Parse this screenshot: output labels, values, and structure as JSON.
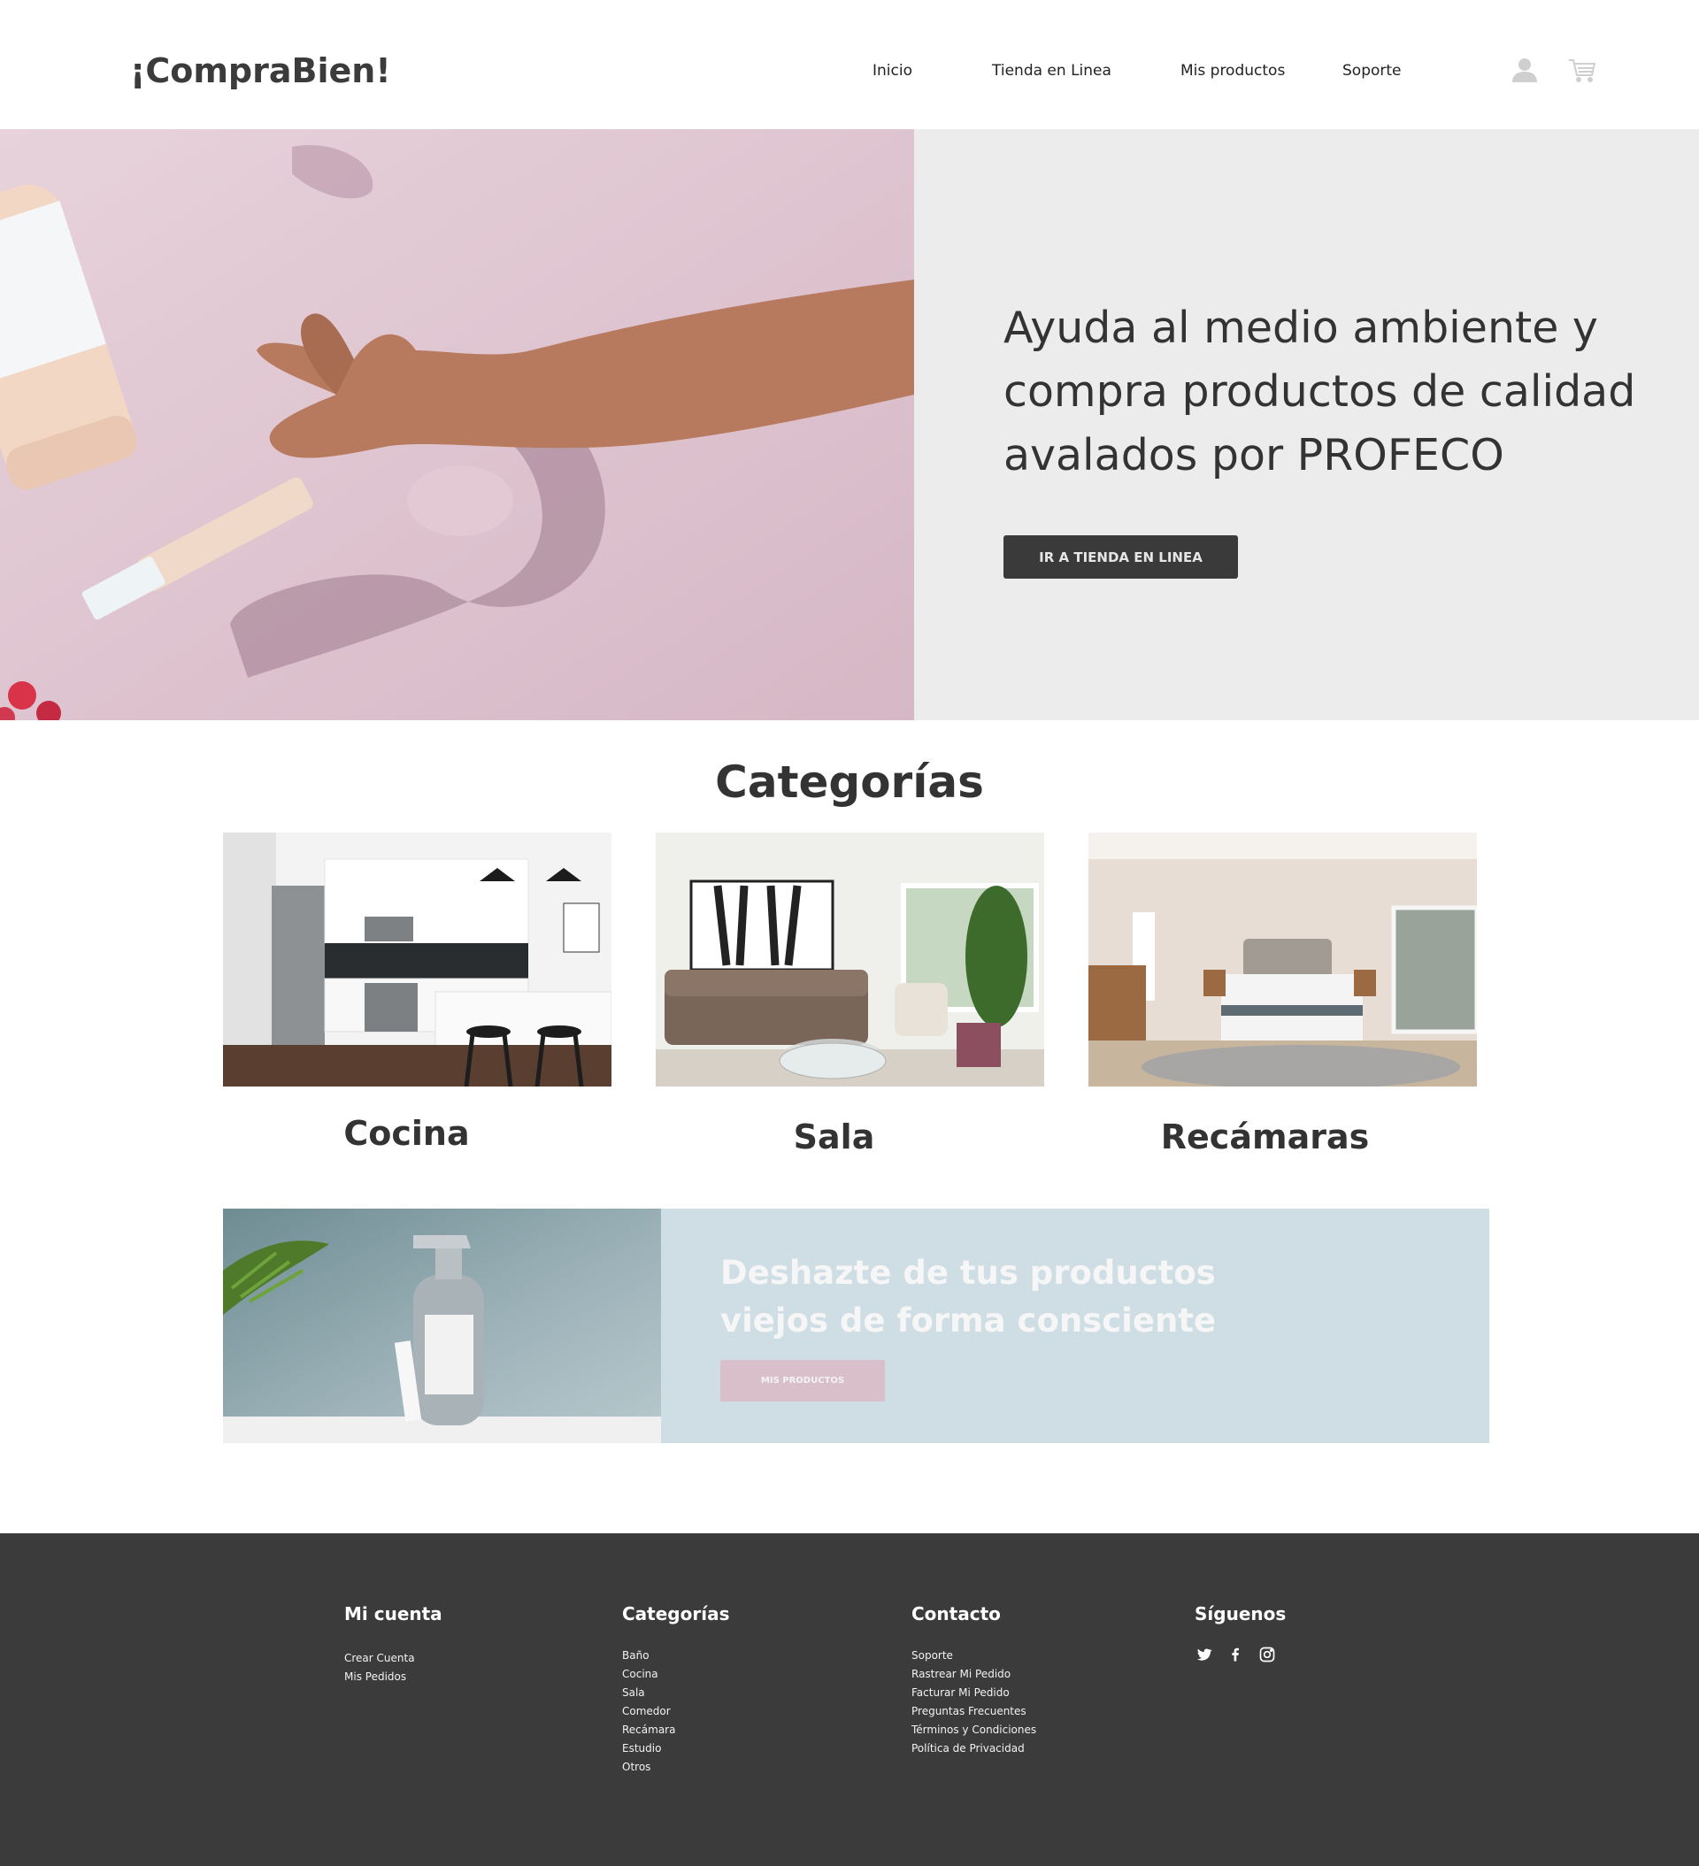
{
  "header": {
    "logo": "¡CompraBien!",
    "nav": {
      "inicio": "Inicio",
      "tienda": "Tienda en Linea",
      "mis_productos": "Mis productos",
      "soporte": "Soporte"
    },
    "icons": [
      "user-icon",
      "cart-icon"
    ]
  },
  "hero": {
    "title": "Ayuda al medio ambiente y compra productos de calidad avalados por PROFECO",
    "button_label": "IR A TIENDA EN LINEA",
    "image": "hand-holding-product-photo"
  },
  "categories": {
    "heading": "Categorías",
    "items": [
      {
        "label": "Cocina",
        "image": "kitchen-photo"
      },
      {
        "label": "Sala",
        "image": "living-room-photo"
      },
      {
        "label": "Recámaras",
        "image": "bedroom-photo"
      }
    ]
  },
  "promo": {
    "title": "Deshazte de tus productos viejos de forma consciente",
    "button_label": "MIS PRODUCTOS",
    "image": "spray-bottle-photo"
  },
  "footer": {
    "mi_cuenta": {
      "heading": "Mi cuenta",
      "links": [
        "Crear Cuenta",
        "Mis Pedidos"
      ]
    },
    "categorias": {
      "heading": "Categorías",
      "links": [
        "Baño",
        "Cocina",
        "Sala",
        "Comedor",
        "Recámara",
        "Estudio",
        "Otros"
      ]
    },
    "contacto": {
      "heading": "Contacto",
      "links": [
        "Soporte",
        "Rastrear Mi Pedido",
        "Facturar Mi Pedido",
        "Preguntas Frecuentes",
        "Términos y Condiciones",
        "Política de Privacidad"
      ]
    },
    "siguenos": {
      "heading": "Síguenos",
      "icons": [
        "twitter-icon",
        "facebook-icon",
        "instagram-icon"
      ]
    }
  },
  "colors": {
    "dark": "#3b3b3b",
    "hero_panel": "#ececec",
    "hero_image_bg": "#d8bdc9",
    "promo_panel": "#cedee4",
    "promo_button": "#d8bfc9"
  }
}
